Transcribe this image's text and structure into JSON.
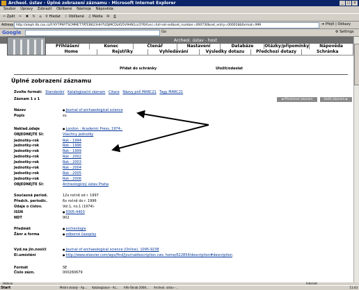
{
  "window": {
    "title": "Archeol. ústav - Úplné zobrazení záznamu - Microsoft Internet Explorer",
    "controls": [
      "_",
      "□",
      "x"
    ]
  },
  "menu": [
    "Soubor",
    "Úpravy",
    "Zobrazit",
    "Oblíbené",
    "Nástroje",
    "Nápověda"
  ],
  "toolbar": [
    "Zpět",
    "Hledat",
    "Oblíbené",
    "Média"
  ],
  "address": {
    "label": "Adresa",
    "url": "http://aleph.lib.cas.cz/F/XY7PNYTSCMMET7RTEB623HH7UDJMCDLKS5V9HN1ccO76/func=full-set-set&set_number=000730&set_entry=000018&format=999",
    "go": "Přejít",
    "links": "Odkazy"
  },
  "google": {
    "logo": "Google",
    "go": "Go",
    "settings": "Settings"
  },
  "page": {
    "institute": "Archeol. ústav - host",
    "nav_top": [
      "Přihlášení",
      "Konec",
      "Čtenář",
      "Nastavení zobrazení",
      "Databáze",
      "Otázky/připomínky",
      "Nápověda"
    ],
    "nav_bottom": [
      "Home",
      "Rejstříky",
      "Vyhledávání",
      "Výsledky dotazu",
      "Předchozí dotazy",
      "Schránka"
    ],
    "action_add": "Přidat do schránky",
    "action_save": "Uložit/odeslat",
    "title": "Úplné zobrazení záznamu",
    "format_label": "Zvolte formát:",
    "formats": [
      "Standardní",
      "Katalogizační záznam",
      "Citace",
      "Názvy polí MARC21",
      "Tagy MARC21"
    ],
    "record": "Záznam 1 z 1",
    "prev_btn": "◄ Předchozí záznam",
    "next_btn": "Další záznam ►"
  },
  "fields": [
    {
      "k": "Název",
      "v": "Journal of archaeological science",
      "link": true,
      "bullet": true
    },
    {
      "k": "Popis",
      "v": "sv."
    },
    {
      "k": "Naklad.údaje",
      "v": "London : Academic Press, 1974-.",
      "link": true,
      "bullet": true
    },
    {
      "k": "OBJEDNEJTE SI:",
      "v": "Všechny jednotky",
      "link": true
    },
    {
      "k": "Jednotky-rok",
      "v": "Rok - 1994",
      "link": true
    },
    {
      "k": "Jednotky-rok",
      "v": "Rok - 1996",
      "link": true
    },
    {
      "k": "Jednotky-rok",
      "v": "Rok - 1999",
      "link": true
    },
    {
      "k": "Jednotky-rok",
      "v": "Rok - 2002",
      "link": true
    },
    {
      "k": "Jednotky-rok",
      "v": "Rok - 2003",
      "link": true
    },
    {
      "k": "Jednotky-rok",
      "v": "Rok - 2004",
      "link": true
    },
    {
      "k": "Jednotky-rok",
      "v": "Rok - 2005",
      "link": true
    },
    {
      "k": "Jednotky-rok",
      "v": "Rok - 2006",
      "link": true
    },
    {
      "k": "OBJEDNEJTE SI:",
      "v": "Archeologický ústav Praha",
      "link": true
    },
    {
      "k": "Současná period.",
      "v": "12x ročně od r. 1997"
    },
    {
      "k": "Předch. periodic.",
      "v": "6x ročně do r. 1996"
    },
    {
      "k": "Údaje o číslov.",
      "v": "Vol.1, no.1 (1974)-"
    },
    {
      "k": "ISSN",
      "v": "0305-4403",
      "link": true,
      "bullet": true
    },
    {
      "k": "NDT",
      "v": "902"
    },
    {
      "k": "Předmět",
      "v": "archeologie",
      "link": true,
      "bullet": true
    },
    {
      "k": "Žánr a forma",
      "v": "odborné časopisy",
      "link": true,
      "bullet": true
    },
    {
      "k": "Vyd.na jin.nosiči",
      "v": "Journal of archaeological science (Online). 1095-9238",
      "link": true,
      "bullet": true
    },
    {
      "k": "El.umístění",
      "v": "http://www.elsevier.com/wps/find/journaldescription.cws_home/622854/description#description",
      "link": true,
      "bullet": true
    },
    {
      "k": "Formát",
      "v": "SE"
    },
    {
      "k": "Číslo zázn.",
      "v": "000260679"
    }
  ],
  "status": {
    "left": "Hotovo",
    "right": "Internet"
  },
  "taskbar": {
    "start": "Start",
    "tasks": [
      "Místní sklady - Ap...",
      "Katalogizace - AL...",
      "Alfo-Škrab 2006...",
      "Archeol. ústav -..."
    ],
    "clock": "11:43"
  }
}
